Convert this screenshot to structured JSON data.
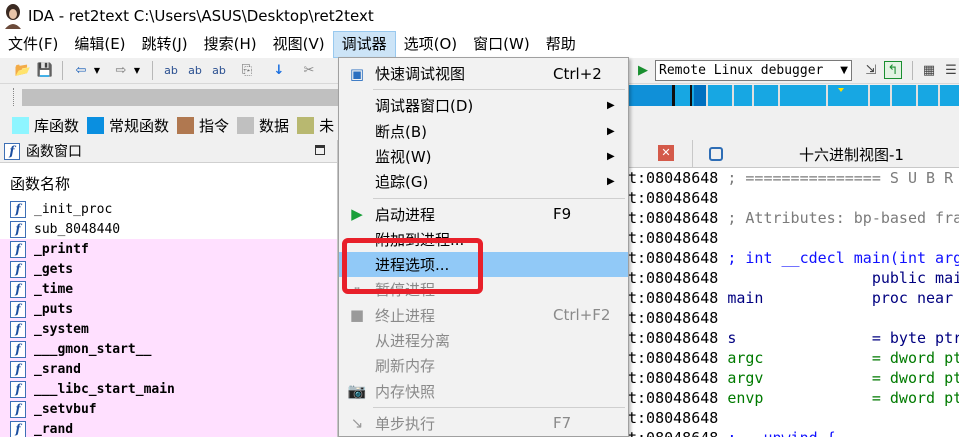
{
  "window": {
    "title": "IDA - ret2text C:\\Users\\ASUS\\Desktop\\ret2text"
  },
  "menubar": [
    {
      "label": "文件(F)"
    },
    {
      "label": "编辑(E)"
    },
    {
      "label": "跳转(J)"
    },
    {
      "label": "搜索(H)"
    },
    {
      "label": "视图(V)"
    },
    {
      "label": "调试器",
      "active": true
    },
    {
      "label": "选项(O)"
    },
    {
      "label": "窗口(W)"
    },
    {
      "label": "帮助"
    }
  ],
  "toolbar": {
    "debugger_select": "Remote Linux debugger"
  },
  "legend": [
    {
      "label": "库函数",
      "color": "#8ef5ff"
    },
    {
      "label": "常规函数",
      "color": "#0a8fe0"
    },
    {
      "label": "指令",
      "color": "#b07850"
    },
    {
      "label": "数据",
      "color": "#c0c0c0"
    },
    {
      "label": "未",
      "color": "#b8b870"
    }
  ],
  "function_window": {
    "title": "函数窗口",
    "column": "函数名称",
    "functions": [
      {
        "name": "_init_proc",
        "library": false
      },
      {
        "name": "sub_8048440",
        "library": false
      },
      {
        "name": "_printf",
        "library": true
      },
      {
        "name": "_gets",
        "library": true
      },
      {
        "name": "_time",
        "library": true
      },
      {
        "name": "_puts",
        "library": true
      },
      {
        "name": "_system",
        "library": true
      },
      {
        "name": "___gmon_start__",
        "library": true
      },
      {
        "name": "_srand",
        "library": true
      },
      {
        "name": "___libc_start_main",
        "library": true
      },
      {
        "name": "_setvbuf",
        "library": true
      },
      {
        "name": "_rand",
        "library": true
      }
    ]
  },
  "tabs": {
    "hex_view": "十六进制视图-1"
  },
  "disassembly": {
    "lines": [
      {
        "addr": "t:08048648",
        "text": " ; =============== S U B R",
        "color": "gray"
      },
      {
        "addr": "t:08048648",
        "text": "",
        "color": "black"
      },
      {
        "addr": "t:08048648",
        "text": " ; Attributes: bp-based fra",
        "color": "gray"
      },
      {
        "addr": "t:08048648",
        "text": "",
        "color": "black"
      },
      {
        "addr": "t:08048648",
        "text": " ; int __cdecl main(int arg",
        "color": "blue"
      },
      {
        "addr": "t:08048648",
        "text": "                 public mai",
        "color": "navy"
      },
      {
        "addr": "t:08048648",
        "text": " main            proc near",
        "color": "navy"
      },
      {
        "addr": "t:08048648",
        "text": "",
        "color": "black"
      },
      {
        "addr": "t:08048648",
        "text": " s               = byte ptr",
        "color": "navy"
      },
      {
        "addr": "t:08048648",
        "text": " argc            = dword pt",
        "color": "green"
      },
      {
        "addr": "t:08048648",
        "text": " argv            = dword pt",
        "color": "green"
      },
      {
        "addr": "t:08048648",
        "text": " envp            = dword pt",
        "color": "green"
      },
      {
        "addr": "t:08048648",
        "text": "",
        "color": "black"
      },
      {
        "addr": "t:08048648",
        "text": " ; __unwind {",
        "color": "blue"
      }
    ]
  },
  "debugger_menu": {
    "items": [
      {
        "type": "item",
        "icon": "quick-debug-view-icon",
        "glyph": "▣",
        "label": "快速调试视图",
        "shortcut": "Ctrl+2",
        "disabled": false,
        "submenu": false
      },
      {
        "type": "sep"
      },
      {
        "type": "item",
        "label": "调试器窗口(D)",
        "shortcut": "",
        "disabled": false,
        "submenu": true
      },
      {
        "type": "item",
        "label": "断点(B)",
        "shortcut": "",
        "disabled": false,
        "submenu": true
      },
      {
        "type": "item",
        "label": "监视(W)",
        "shortcut": "",
        "disabled": false,
        "submenu": true
      },
      {
        "type": "item",
        "label": "追踪(G)",
        "shortcut": "",
        "disabled": false,
        "submenu": true
      },
      {
        "type": "sep"
      },
      {
        "type": "item",
        "icon": "start-process-icon",
        "glyph": "▶",
        "label": "启动进程",
        "shortcut": "F9",
        "disabled": false,
        "submenu": false
      },
      {
        "type": "item",
        "label": "附加到进程...",
        "shortcut": "",
        "disabled": false,
        "submenu": false
      },
      {
        "type": "item",
        "label": "进程选项...",
        "shortcut": "",
        "disabled": false,
        "submenu": false,
        "highlighted": true
      },
      {
        "type": "item",
        "icon": "pause-process-icon",
        "glyph": "⏸",
        "label": "暂停进程",
        "shortcut": "",
        "disabled": true,
        "submenu": false
      },
      {
        "type": "item",
        "icon": "terminate-process-icon",
        "glyph": "■",
        "label": "终止进程",
        "shortcut": "Ctrl+F2",
        "disabled": true,
        "submenu": false
      },
      {
        "type": "item",
        "label": "从进程分离",
        "shortcut": "",
        "disabled": true,
        "submenu": false
      },
      {
        "type": "item",
        "label": "刷新内存",
        "shortcut": "",
        "disabled": true,
        "submenu": false
      },
      {
        "type": "item",
        "icon": "memory-snapshot-icon",
        "glyph": "📷",
        "label": "内存快照",
        "shortcut": "",
        "disabled": true,
        "submenu": false
      },
      {
        "type": "sep"
      },
      {
        "type": "item",
        "icon": "step-into-icon",
        "glyph": "↘",
        "label": "单步执行",
        "shortcut": "F7",
        "disabled": true,
        "submenu": false
      }
    ]
  },
  "colors": {
    "highlight": "#91c9f7",
    "annotation_box": "#e8202a",
    "library_row": "#ffe0ff"
  }
}
